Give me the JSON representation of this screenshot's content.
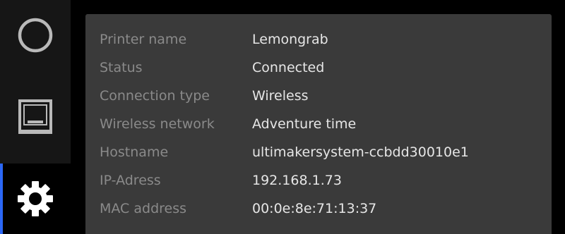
{
  "colors": {
    "accent": "#2b67f6",
    "panel_bg": "#3a3a3a",
    "sidebar_bg": "#161616",
    "label_text": "#8a8a8a",
    "value_text": "#e6e6e6",
    "icon": "#b9b9b9",
    "active_icon": "#ffffff"
  },
  "sidebar": {
    "items": [
      {
        "icon": "circle-home-icon",
        "active": false
      },
      {
        "icon": "print-queue-icon",
        "active": false
      },
      {
        "icon": "settings-gear-icon",
        "active": true
      }
    ]
  },
  "info": {
    "rows": [
      {
        "label": "Printer name",
        "value": "Lemongrab"
      },
      {
        "label": "Status",
        "value": "Connected"
      },
      {
        "label": "Connection type",
        "value": "Wireless"
      },
      {
        "label": "Wireless network",
        "value": "Adventure time"
      },
      {
        "label": "Hostname",
        "value": "ultimakersystem-ccbdd30010e1"
      },
      {
        "label": "IP-Adress",
        "value": "192.168.1.73"
      },
      {
        "label": "MAC address",
        "value": "00:0e:8e:71:13:37"
      }
    ]
  }
}
